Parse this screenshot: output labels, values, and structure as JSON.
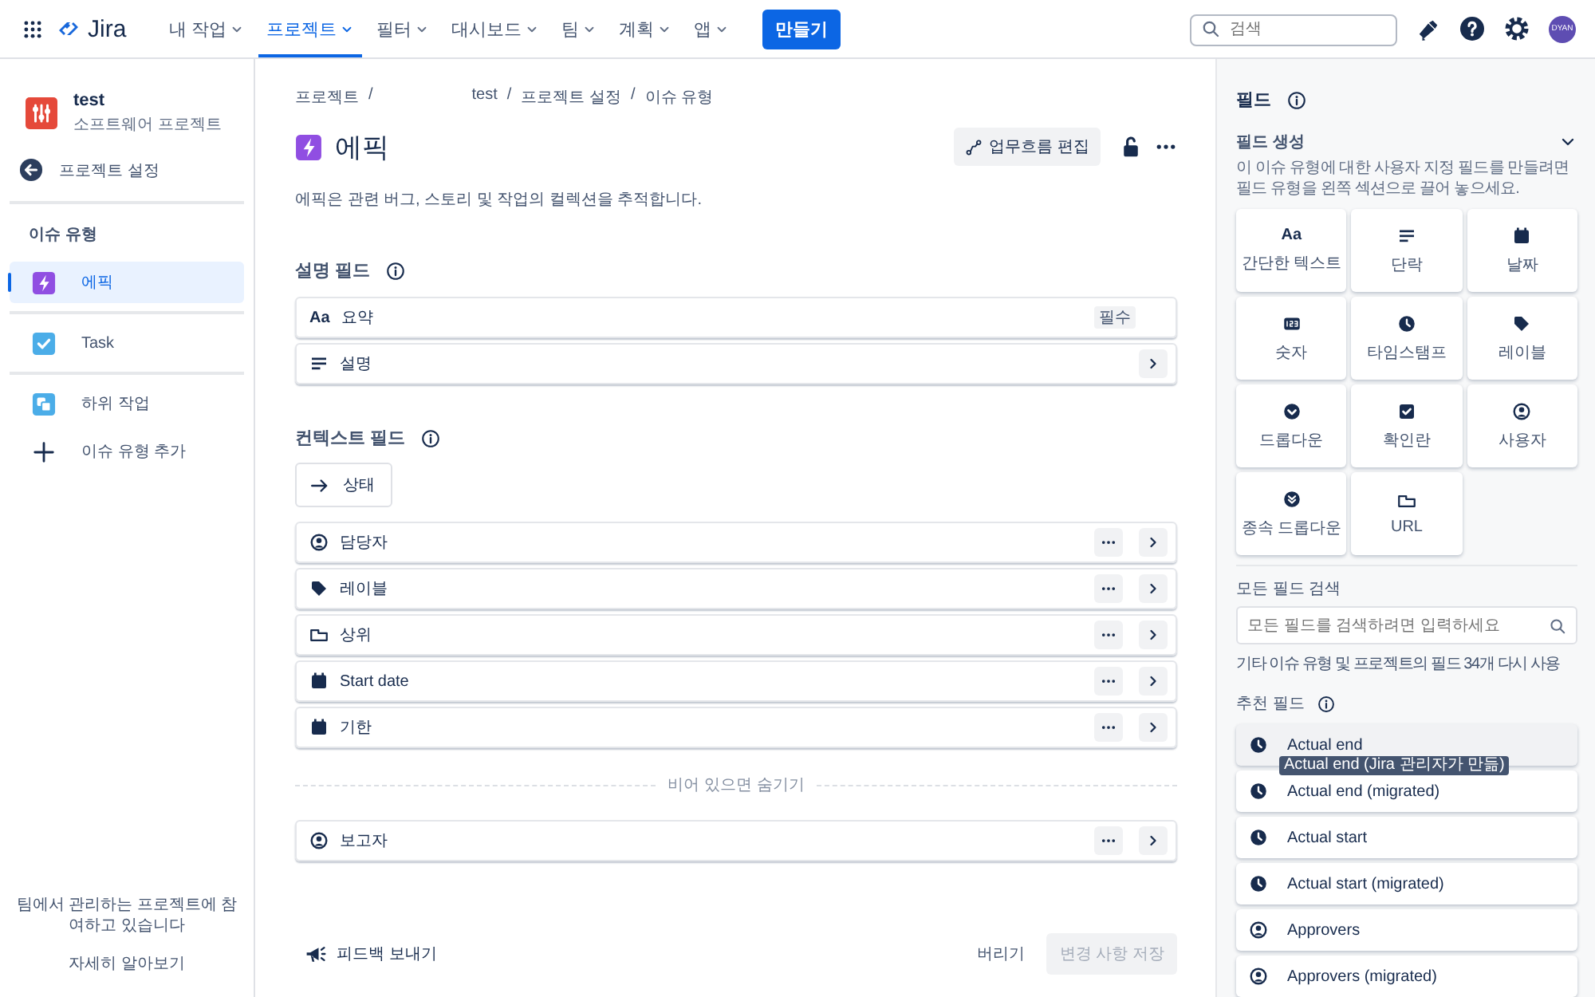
{
  "top_bar": {
    "logo": "Jira",
    "menus": [
      {
        "label": "내 작업",
        "selected": false
      },
      {
        "label": "프로젝트",
        "selected": true
      },
      {
        "label": "필터",
        "selected": false
      },
      {
        "label": "대시보드",
        "selected": false
      },
      {
        "label": "팀",
        "selected": false
      },
      {
        "label": "계획",
        "selected": false
      },
      {
        "label": "앱",
        "selected": false
      }
    ],
    "create_button": "만들기",
    "search": {
      "placeholder": "검색"
    },
    "avatar": "DYAN"
  },
  "sidebar": {
    "project": {
      "name": "test",
      "type": "소프트웨어 프로젝트"
    },
    "back_link": "프로젝트 설정",
    "section_title": "이슈 유형",
    "issue_types": [
      {
        "label": "에픽",
        "kind": "epic",
        "selected": true
      },
      {
        "label": "Task",
        "kind": "task",
        "selected": false
      },
      {
        "label": "하위 작업",
        "kind": "subtask",
        "selected": false
      }
    ],
    "add_label": "이슈 유형 추가",
    "footer": {
      "text": "팀에서 관리하는 프로젝트에 참여하고 있습니다",
      "link": "자세히 알아보기"
    }
  },
  "main": {
    "breadcrumbs": [
      "프로젝트",
      "test",
      "프로젝트 설정",
      "이슈 유형"
    ],
    "separator": "/",
    "title": "에픽",
    "workflow_button": "업무흐름 편집",
    "description": "에픽은 관련 버그, 스토리 및 작업의 컬렉션을 추적합니다.",
    "description_fields": {
      "title": "설명 필드",
      "fields": [
        {
          "kind": "text",
          "icon_text": "Aa",
          "label": "요약",
          "badge": "필수",
          "menu": false,
          "chevron": false
        },
        {
          "kind": "paragraph",
          "label": "설명",
          "menu": false,
          "chevron": true
        }
      ]
    },
    "context_fields": {
      "title": "컨텍스트 필드",
      "status": "상태",
      "fields": [
        {
          "kind": "user",
          "label": "담당자",
          "menu": true,
          "chevron": true
        },
        {
          "kind": "tag",
          "label": "레이블",
          "menu": true,
          "chevron": true
        },
        {
          "kind": "url",
          "label": "상위",
          "menu": true,
          "chevron": true
        },
        {
          "kind": "calendar",
          "label": "Start date",
          "menu": true,
          "chevron": true
        },
        {
          "kind": "calendar",
          "label": "기한",
          "menu": true,
          "chevron": true
        }
      ],
      "hide_divider": "비어 있으면 숨기기",
      "hidden_fields": [
        {
          "kind": "user",
          "label": "보고자",
          "menu": true,
          "chevron": true
        }
      ]
    },
    "footer": {
      "feedback": "피드백 보내기",
      "discard": "버리기",
      "save": {
        "label": "변경 사항 저장",
        "disabled": true
      }
    }
  },
  "field_panel": {
    "title": "필드",
    "create": {
      "title": "필드 생성",
      "expanded": true,
      "hint": "이 이슈 유형에 대한 사용자 지정 필드를 만들려면 필드 유형을 왼쪽 섹션으로 끌어 놓으세요.",
      "types": [
        {
          "kind": "text",
          "icon_text": "Aa",
          "label": "간단한 텍스트"
        },
        {
          "kind": "paragraph",
          "label": "단락"
        },
        {
          "kind": "calendar",
          "label": "날짜"
        },
        {
          "kind": "number",
          "label": "숫자"
        },
        {
          "kind": "clock",
          "label": "타임스탬프"
        },
        {
          "kind": "tag",
          "label": "레이블"
        },
        {
          "kind": "dropdown",
          "label": "드롭다운"
        },
        {
          "kind": "checkbox",
          "label": "확인란"
        },
        {
          "kind": "user",
          "label": "사용자"
        },
        {
          "kind": "cascade",
          "label": "종속 드롭다운"
        },
        {
          "kind": "url",
          "label": "URL"
        }
      ]
    },
    "search": {
      "label": "모든 필드 검색",
      "placeholder": "모든 필드를 검색하려면 입력하세요",
      "hint": "기타 이슈 유형 및 프로젝트의 필드 34개 다시 사용"
    },
    "suggested": {
      "title": "추천 필드",
      "tooltip": "Actual end (Jira 관리자가 만듦)",
      "items": [
        {
          "kind": "clock",
          "label": "Actual end",
          "hovered": true
        },
        {
          "kind": "clock",
          "label": "Actual end (migrated)",
          "hovered": false
        },
        {
          "kind": "clock",
          "label": "Actual start",
          "hovered": false
        },
        {
          "kind": "clock",
          "label": "Actual start (migrated)",
          "hovered": false
        },
        {
          "kind": "user",
          "label": "Approvers",
          "hovered": false
        },
        {
          "kind": "user",
          "label": "Approvers (migrated)",
          "hovered": false
        }
      ]
    }
  }
}
